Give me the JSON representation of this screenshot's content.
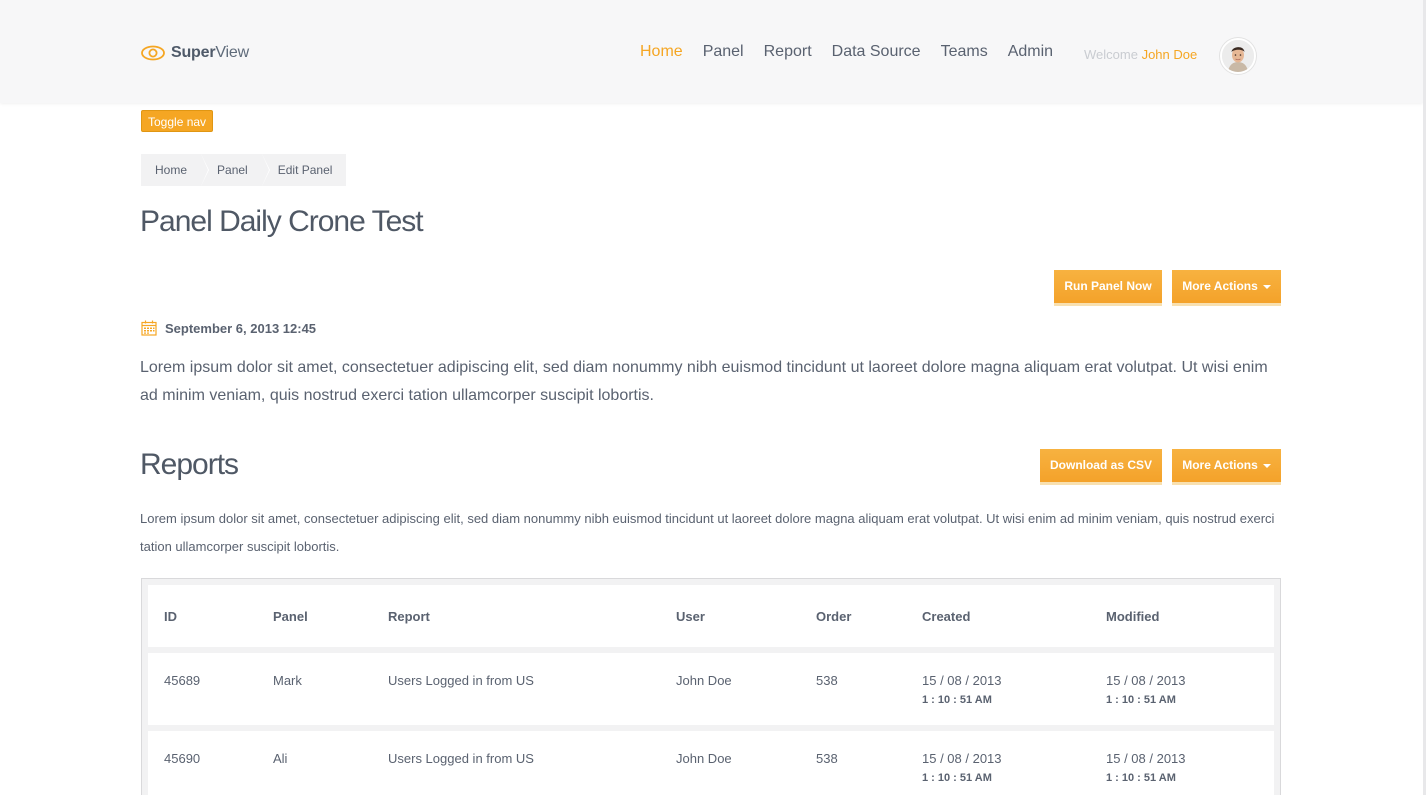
{
  "header": {
    "logo_bold": "Super",
    "logo_light": "View",
    "nav": [
      "Home",
      "Panel",
      "Report",
      "Data Source",
      "Teams",
      "Admin"
    ],
    "welcome_label": "Welcome",
    "user_name": "John Doe"
  },
  "toggle_nav_label": "Toggle nav",
  "breadcrumb": [
    "Home",
    "Panel",
    "Edit Panel"
  ],
  "page_title": "Panel Daily Crone Test",
  "actions": {
    "run_panel_now": "Run Panel Now",
    "more_actions": "More Actions",
    "download_csv": "Download as CSV"
  },
  "panel_date": "September 6, 2013 12:45",
  "intro_text": "Lorem ipsum dolor sit amet, consectetuer adipiscing elit, sed diam nonummy nibh euismod tincidunt ut laoreet dolore magna aliquam erat volutpat. Ut wisi enim ad minim veniam, quis nostrud exerci tation ullamcorper suscipit lobortis.",
  "reports": {
    "title": "Reports",
    "description": "Lorem ipsum dolor sit amet, consectetuer adipiscing elit, sed diam nonummy nibh euismod tincidunt ut laoreet dolore magna aliquam erat volutpat. Ut wisi enim ad minim veniam, quis nostrud exerci tation ullamcorper suscipit lobortis.",
    "columns": [
      "ID",
      "Panel",
      "Report",
      "User",
      "Order",
      "Created",
      "Modified"
    ],
    "rows": [
      {
        "id": "45689",
        "panel": "Mark",
        "report": "Users Logged in from US",
        "user": "John Doe",
        "order": "538",
        "created_date": "15 / 08 / 2013",
        "created_time": "1 : 10 : 51 AM",
        "modified_date": "15 / 08 / 2013",
        "modified_time": "1 : 10 : 51 AM"
      },
      {
        "id": "45690",
        "panel": "Ali",
        "report": "Users Logged in from US",
        "user": "John Doe",
        "order": "538",
        "created_date": "15 / 08 / 2013",
        "created_time": "1 : 10 : 51 AM",
        "modified_date": "15 / 08 / 2013",
        "modified_time": "1 : 10 : 51 AM"
      }
    ]
  },
  "colors": {
    "accent": "#f5a623",
    "text": "#5a6270",
    "title": "#4f5865"
  },
  "icons": {
    "logo": "eye-icon",
    "date": "calendar-icon",
    "caret": "caret-down-icon"
  }
}
